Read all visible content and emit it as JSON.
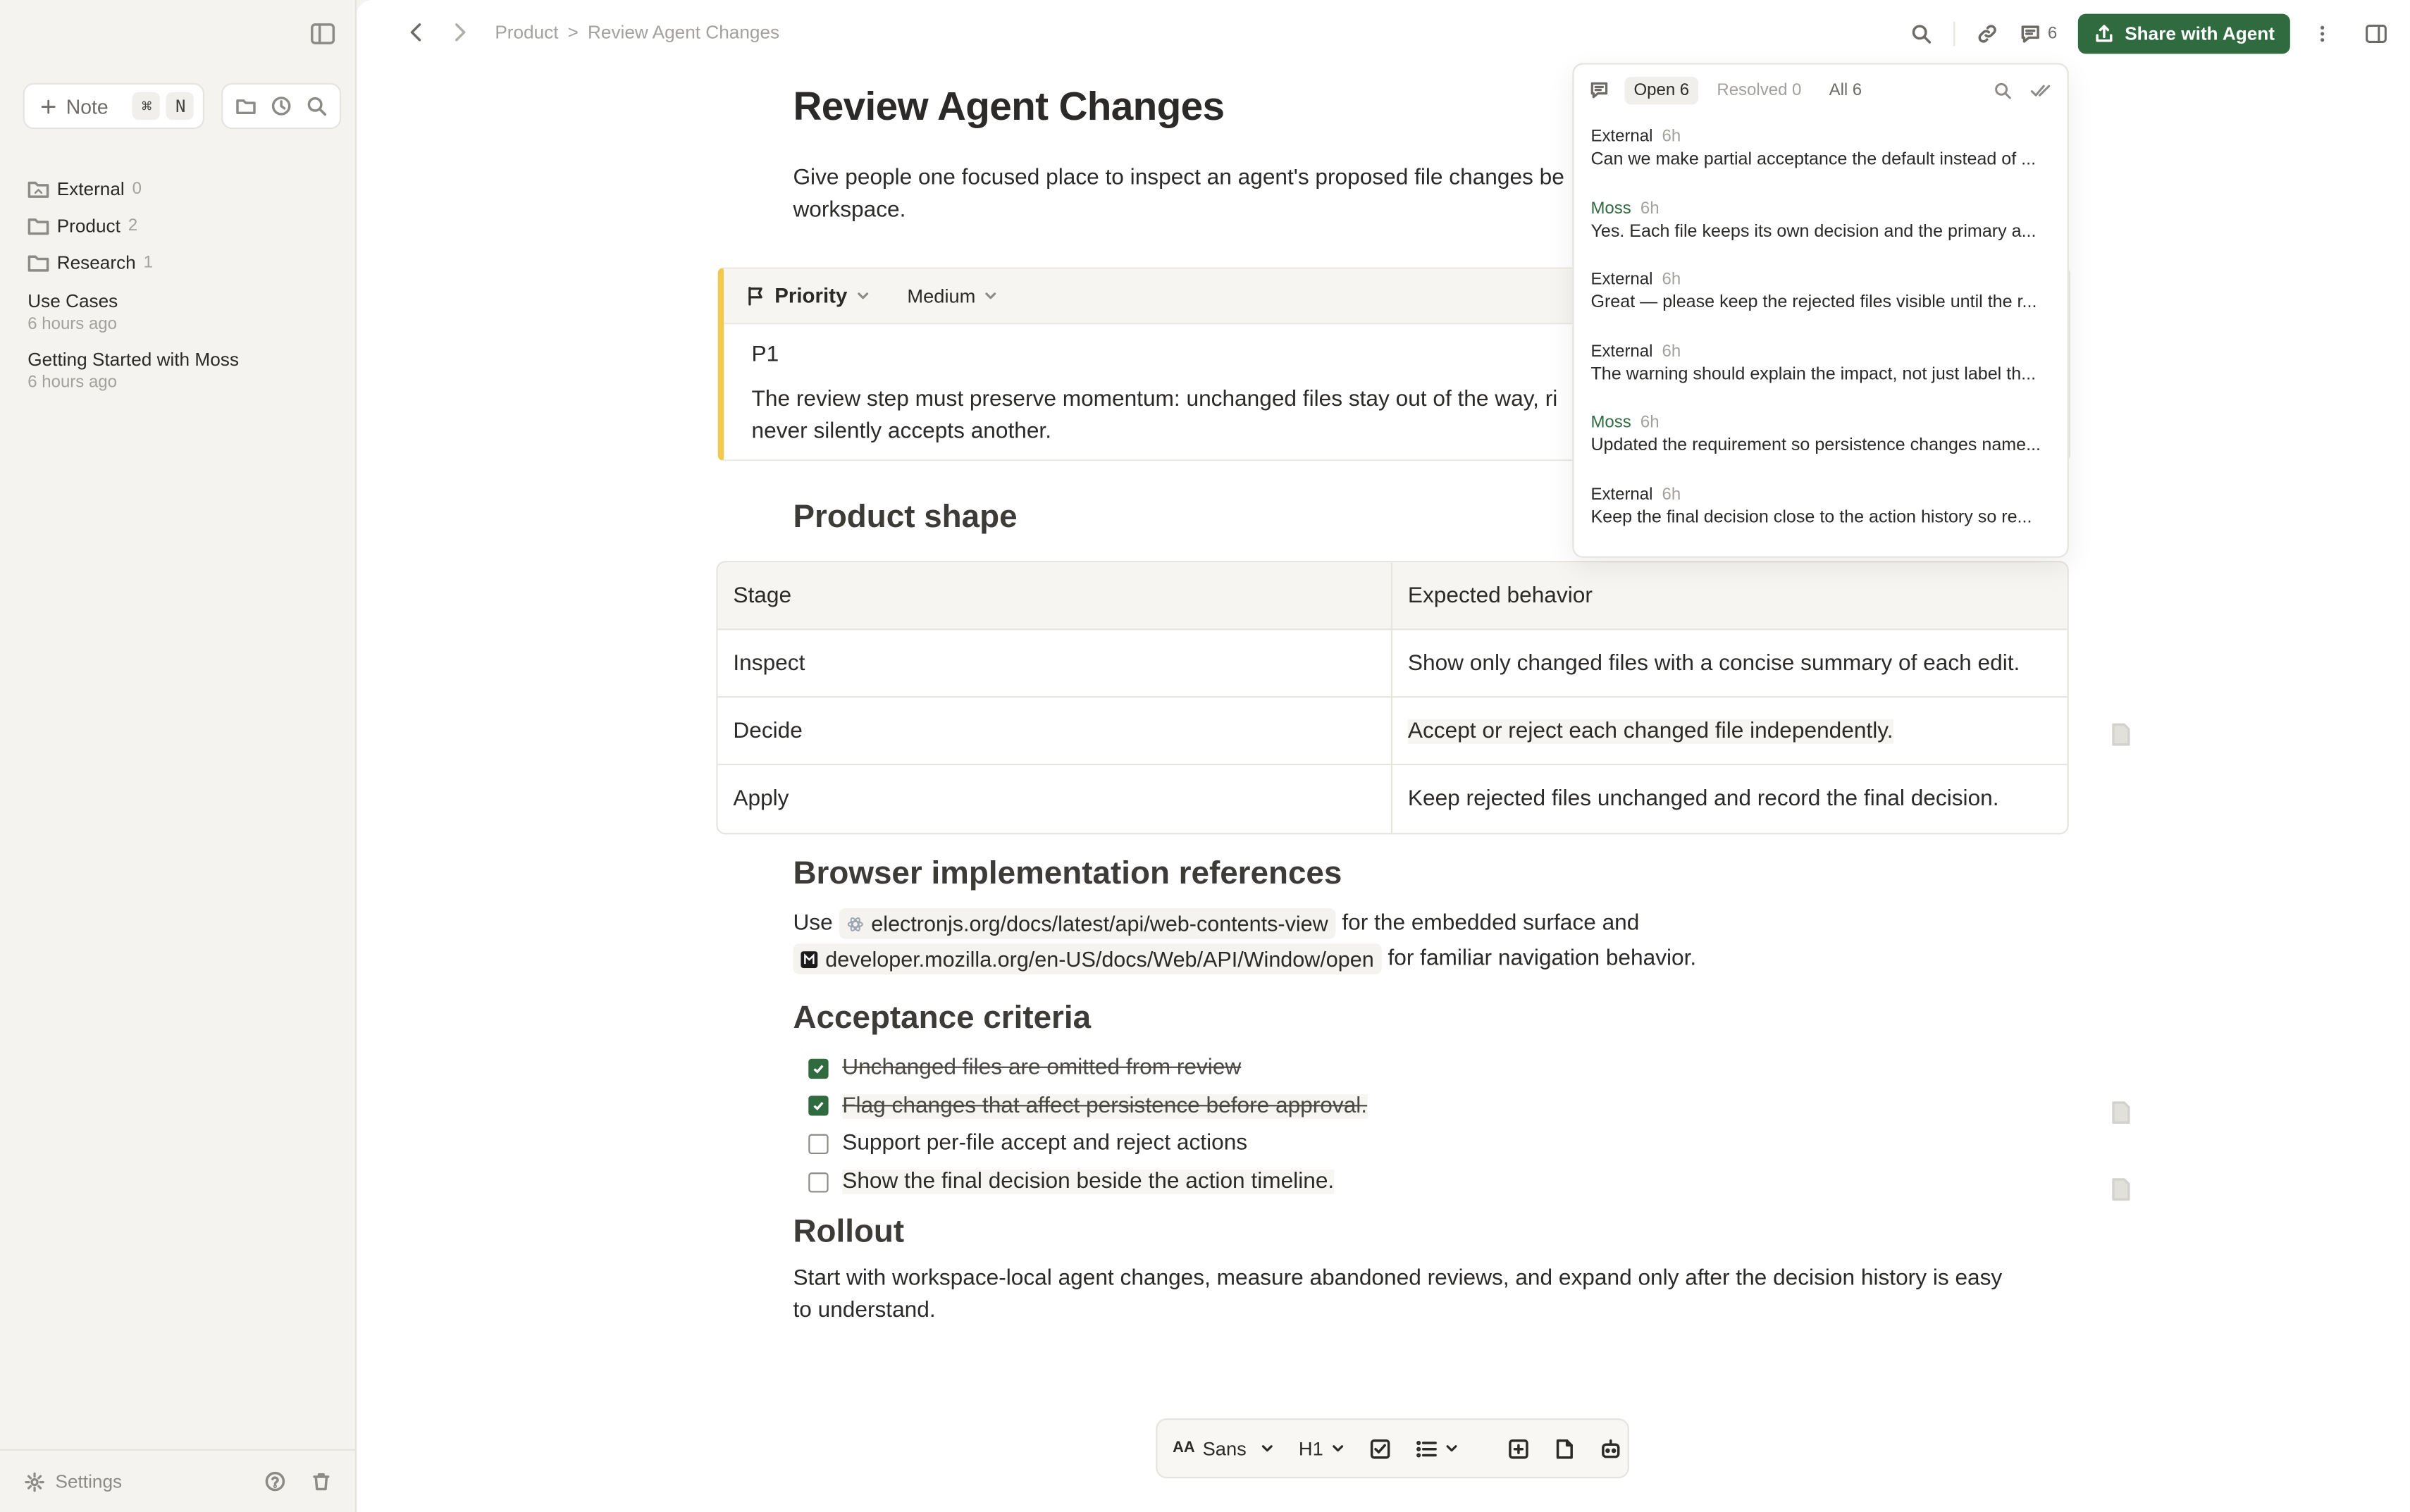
{
  "sidebar": {
    "new_note_label": "Note",
    "shortcut_keys": [
      "⌘",
      "N"
    ],
    "folders": [
      {
        "name": "External",
        "count": "0"
      },
      {
        "name": "Product",
        "count": "2"
      },
      {
        "name": "Research",
        "count": "1"
      }
    ],
    "docs": [
      {
        "title": "Use Cases",
        "time": "6 hours ago"
      },
      {
        "title": "Getting Started with Moss",
        "time": "6 hours ago"
      }
    ],
    "settings_label": "Settings"
  },
  "topbar": {
    "breadcrumb": [
      "Product",
      "Review Agent Changes"
    ],
    "breadcrumb_sep": ">",
    "comment_count": "6",
    "share_label": "Share with Agent"
  },
  "doc": {
    "title": "Review Agent Changes",
    "lead": "Give people one focused place to inspect an agent's proposed file changes be workspace.",
    "priority": {
      "label": "Priority",
      "value": "Medium",
      "heading": "P1",
      "body": "The review step must preserve momentum: unchanged files stay out of the way, ri never silently accepts another."
    },
    "product_shape": {
      "heading": "Product shape",
      "columns": [
        "Stage",
        "Expected behavior"
      ],
      "rows": [
        [
          "Inspect",
          "Show only changed files with a concise summary of each edit."
        ],
        [
          "Decide",
          "Accept or reject each changed file independently."
        ],
        [
          "Apply",
          "Keep rejected files unchanged and record the final decision."
        ]
      ]
    },
    "browser": {
      "heading": "Browser implementation references",
      "pre": "Use",
      "link1": "electronjs.org/docs/latest/api/web-contents-view",
      "mid": "for the embedded surface and",
      "link2": "developer.mozilla.org/en-US/docs/Web/API/Window/open",
      "post": "for familiar navigation behavior."
    },
    "acceptance": {
      "heading": "Acceptance criteria",
      "items": [
        {
          "text": "Unchanged files are omitted from review",
          "checked": true
        },
        {
          "text": "Flag changes that affect persistence before approval.",
          "checked": true
        },
        {
          "text": "Support per-file accept and reject actions",
          "checked": false
        },
        {
          "text": "Show the final decision beside the action timeline.",
          "checked": false
        }
      ]
    },
    "rollout": {
      "heading": "Rollout",
      "body": "Start with workspace-local agent changes, measure abandoned reviews, and expand only after the decision history is easy to understand."
    }
  },
  "format_bar": {
    "font": "Sans",
    "font_prefix": "AA",
    "heading": "H1"
  },
  "comments": {
    "tabs": [
      {
        "label": "Open",
        "count": "6"
      },
      {
        "label": "Resolved",
        "count": "0"
      },
      {
        "label": "All",
        "count": "6"
      }
    ],
    "items": [
      {
        "author": "External",
        "age": "6h",
        "text": "Can we make partial acceptance the default instead of ..."
      },
      {
        "author": "Moss",
        "age": "6h",
        "text": "Yes. Each file keeps its own decision and the primary a..."
      },
      {
        "author": "External",
        "age": "6h",
        "text": "Great — please keep the rejected files visible until the r..."
      },
      {
        "author": "External",
        "age": "6h",
        "text": "The warning should explain the impact, not just label th..."
      },
      {
        "author": "Moss",
        "age": "6h",
        "text": "Updated the requirement so persistence changes name..."
      },
      {
        "author": "External",
        "age": "6h",
        "text": "Keep the final decision close to the action history so re..."
      }
    ]
  },
  "colors": {
    "accent": "#2f6b3f",
    "callout_border": "#f2c94c"
  }
}
